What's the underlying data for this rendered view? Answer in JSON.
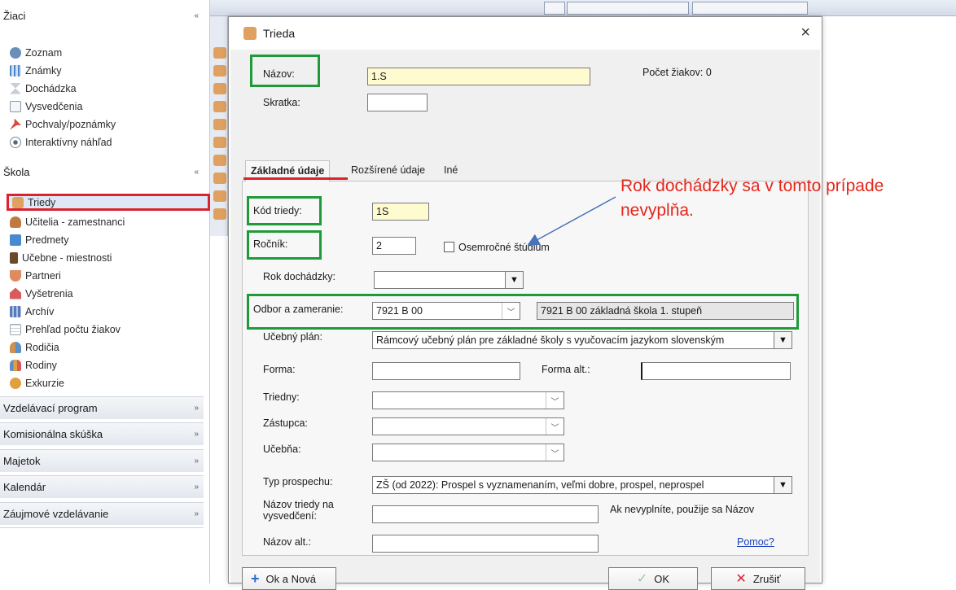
{
  "nav": {
    "sections": [
      {
        "label": "Žiaci",
        "chevron": "«"
      },
      {
        "label": "Škola",
        "chevron": "«"
      },
      {
        "label": "Vzdelávací program",
        "chevron": "»"
      },
      {
        "label": "Komisionálna skúška",
        "chevron": "»"
      },
      {
        "label": "Majetok",
        "chevron": "»"
      },
      {
        "label": "Kalendár",
        "chevron": "»"
      },
      {
        "label": "Záujmové vzdelávanie",
        "chevron": "»"
      }
    ],
    "ziaci_items": [
      {
        "label": "Zoznam",
        "icon": "graduation-cap-icon",
        "color": "#6a8fb8"
      },
      {
        "label": "Známky",
        "icon": "grid-icon",
        "color": "#4a86c8"
      },
      {
        "label": "Dochádzka",
        "icon": "hourglass-icon",
        "color": "#9aa6b2"
      },
      {
        "label": "Vysvedčenia",
        "icon": "certificate-icon",
        "color": "#8899aa"
      },
      {
        "label": "Pochvaly/poznámky",
        "icon": "pin-icon",
        "color": "#d94a3a"
      },
      {
        "label": "Interaktívny náhľad",
        "icon": "eye-icon",
        "color": "#7a8a99"
      }
    ],
    "skola_items": [
      {
        "label": "Triedy",
        "icon": "class-icon",
        "color": "#e0a060"
      },
      {
        "label": "Učitelia - zamestnanci",
        "icon": "teacher-icon",
        "color": "#c07a40"
      },
      {
        "label": "Predmety",
        "icon": "book-icon",
        "color": "#4a8ad0"
      },
      {
        "label": "Učebne - miestnosti",
        "icon": "door-icon",
        "color": "#6b4a2a"
      },
      {
        "label": "Partneri",
        "icon": "handshake-icon",
        "color": "#e08a60"
      },
      {
        "label": "Vyšetrenia",
        "icon": "house-medical-icon",
        "color": "#d95a5a"
      },
      {
        "label": "Archív",
        "icon": "archive-icon",
        "color": "#5a7ab8"
      },
      {
        "label": "Prehľad počtu žiakov",
        "icon": "table-icon",
        "color": "#a0a8b0"
      },
      {
        "label": "Rodičia",
        "icon": "parents-icon",
        "color": "#d09050"
      },
      {
        "label": "Rodiny",
        "icon": "family-icon",
        "color": "#5a90c8"
      },
      {
        "label": "Exkurzie",
        "icon": "excursion-icon",
        "color": "#e0a040"
      }
    ]
  },
  "dialog": {
    "title": "Trieda",
    "close": "×",
    "nazov_label": "Názov:",
    "nazov_value": "1.S",
    "skratka_label": "Skratka:",
    "skratka_value": "",
    "pocet_ziakov": "Počet žiakov: 0",
    "tabs": [
      "Základné údaje",
      "Rozšírené údaje",
      "Iné"
    ],
    "kod_label": "Kód triedy:",
    "kod_value": "1S",
    "rocnik_label": "Ročník:",
    "rocnik_value": "2",
    "osemrocne_label": "Osemročné štúdium",
    "rok_label": "Rok dochádzky:",
    "rok_value": "",
    "odbor_label": "Odbor a zameranie:",
    "odbor_value": "7921 B 00",
    "odbor_desc": "7921 B 00 základná škola 1. stupeň",
    "plan_label": "Učebný plán:",
    "plan_value": "Rámcový učebný plán pre základné školy s vyučovacím jazykom slovenským",
    "forma_label": "Forma:",
    "forma_value": "",
    "forma_alt_label": "Forma alt.:",
    "forma_alt_value": "",
    "triedny_label": "Triedny:",
    "zastupca_label": "Zástupca:",
    "ucebna_label": "Učebňa:",
    "typ_label": "Typ prospechu:",
    "typ_value": "ZŠ (od 2022): Prospel s vyznamenaním, veľmi dobre, prospel, neprospel",
    "nazov_vysv_label_1": "Názov triedy na",
    "nazov_vysv_label_2": "vysvedčení:",
    "nazov_vysv_hint": "Ak nevyplníte, použije sa Názov",
    "nazov_alt_label": "Názov alt.:",
    "pomoc": "Pomoc?",
    "ok_nova": "Ok a Nová",
    "ok": "OK",
    "zrusit": "Zrušiť"
  },
  "annotation": {
    "line1": "Rok dochádzky sa v tomto prípade",
    "line2": "nevyplňa.",
    "color": "#e5271c"
  },
  "colors": {
    "highlight_green": "#1f9a3b",
    "highlight_red": "#d9232e",
    "input_yellow": "#fffbd0"
  }
}
